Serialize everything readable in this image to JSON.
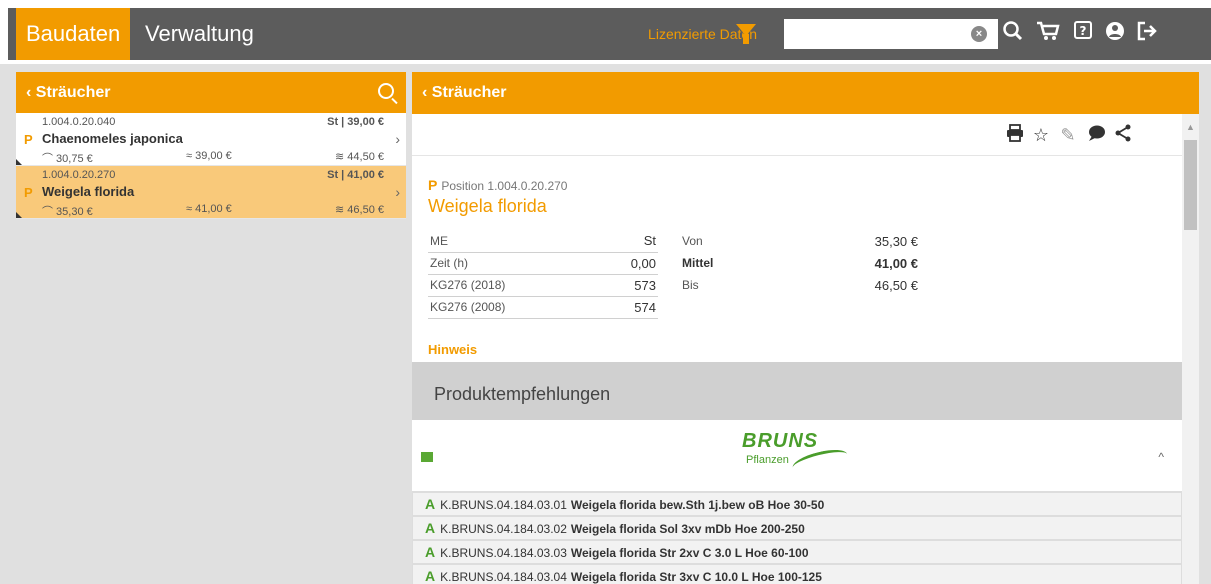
{
  "topbar": {
    "tab_active": "Baudaten",
    "tab_second": "Verwaltung",
    "license": "Lizenzierte Daten",
    "search_value": "",
    "icons": [
      "search-icon",
      "cart-icon",
      "help-icon",
      "user-icon",
      "logout-icon"
    ]
  },
  "left": {
    "title": "Sträucher",
    "items": [
      {
        "code": "1.004.0.20.040",
        "price": "St | 39,00 €",
        "name": "Chaenomeles japonica",
        "v1": "⌒ 30,75 €",
        "v2": "≈ 39,00 €",
        "v3": "≋ 44,50 €"
      },
      {
        "code": "1.004.0.20.270",
        "price": "St | 41,00 €",
        "name": "Weigela florida",
        "v1": "⌒ 35,30 €",
        "v2": "≈ 41,00 €",
        "v3": "≋ 46,50 €"
      }
    ]
  },
  "right": {
    "title": "Sträucher",
    "position_label": "Position",
    "position_code": "1.004.0.20.270",
    "item_title": "Weigela florida",
    "table1": [
      {
        "k": "ME",
        "v": "St"
      },
      {
        "k": "Zeit (h)",
        "v": "0,00"
      },
      {
        "k": "KG276 (2018)",
        "v": "573"
      },
      {
        "k": "KG276 (2008)",
        "v": "574"
      }
    ],
    "table2": [
      {
        "k": "Von",
        "v": "35,30 €"
      },
      {
        "k": "Mittel",
        "v": "41,00 €"
      },
      {
        "k": "Bis",
        "v": "46,50 €"
      }
    ],
    "hinweis": "Hinweis",
    "produkt": "Produktempfehlungen",
    "brand": "BRUNS",
    "brand_sub": "Pflanzen",
    "products": [
      {
        "code": "K.BRUNS.04.184.03.01",
        "desc": "Weigela florida bew.Sth 1j.bew oB Hoe 30-50"
      },
      {
        "code": "K.BRUNS.04.184.03.02",
        "desc": "Weigela florida Sol 3xv mDb Hoe 200-250"
      },
      {
        "code": "K.BRUNS.04.184.03.03",
        "desc": "Weigela florida Str 2xv C 3.0 L Hoe 60-100"
      },
      {
        "code": "K.BRUNS.04.184.03.04",
        "desc": "Weigela florida Str 3xv C 10.0 L Hoe 100-125"
      }
    ]
  }
}
